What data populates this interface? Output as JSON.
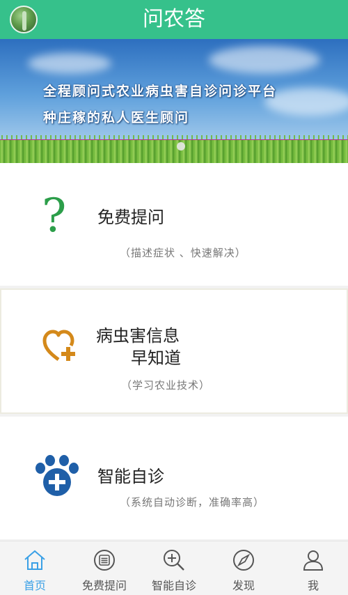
{
  "header": {
    "title": "问农答",
    "avatar_icon": "user-avatar"
  },
  "banner": {
    "line1": "全程顾问式农业病虫害自诊问诊平台",
    "line2": "种庄稼的私人医生顾问"
  },
  "cards": [
    {
      "title": "免费提问",
      "subtitle": "（描述症状 、快速解决）",
      "icon": "question-mark-icon"
    },
    {
      "title_line1": "病虫害信息",
      "title_line2": "早知道",
      "subtitle": "（学习农业技术）",
      "icon": "heart-plus-icon"
    },
    {
      "title": "智能自诊",
      "subtitle": "（系统自动诊断，准确率高）",
      "icon": "paw-plus-icon"
    }
  ],
  "nav": {
    "items": [
      {
        "label": "首页",
        "icon": "home-icon",
        "active": true
      },
      {
        "label": "免费提问",
        "icon": "chat-icon",
        "active": false
      },
      {
        "label": "智能自诊",
        "icon": "zoom-plus-icon",
        "active": false
      },
      {
        "label": "发现",
        "icon": "compass-icon",
        "active": false
      },
      {
        "label": "我",
        "icon": "user-icon",
        "active": false
      }
    ]
  },
  "colors": {
    "primary": "#36c18b",
    "active_nav": "#3aa0e6",
    "question": "#2c9e4a",
    "heart": "#d4891a",
    "paw": "#1f5fa8"
  }
}
